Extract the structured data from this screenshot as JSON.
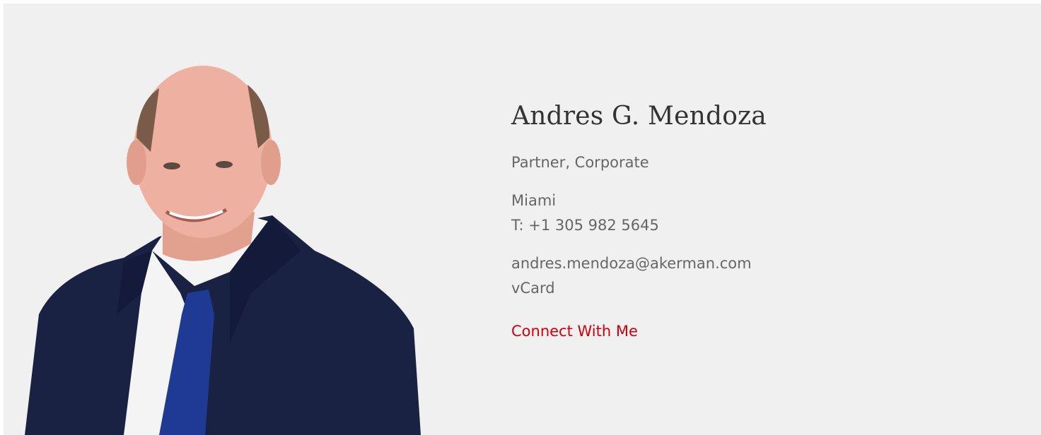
{
  "profile": {
    "name": "Andres G. Mendoza",
    "title": "Partner, Corporate",
    "office": "Miami",
    "phone": "T: +1 305 982 5645",
    "email": "andres.mendoza@akerman.com",
    "vcard_label": "vCard",
    "connect_label": "Connect With Me"
  },
  "colors": {
    "background": "#f0f0f0",
    "text": "#666666",
    "heading": "#333333",
    "accent": "#d2000c"
  }
}
